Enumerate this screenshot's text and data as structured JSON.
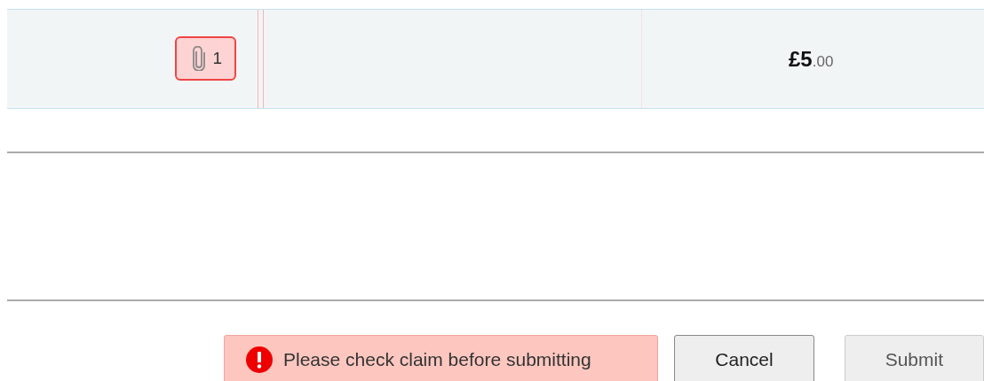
{
  "claim_row": {
    "attachments": {
      "count": "1",
      "flagged": true
    },
    "amount": "**£5**.00"
  },
  "footer": {
    "warning": "Please check claim before submitting",
    "buttons": [
      {
        "label": "Cancel",
        "disabled": false
      },
      {
        "label": "Submit",
        "disabled": true
      }
    ]
  }
}
